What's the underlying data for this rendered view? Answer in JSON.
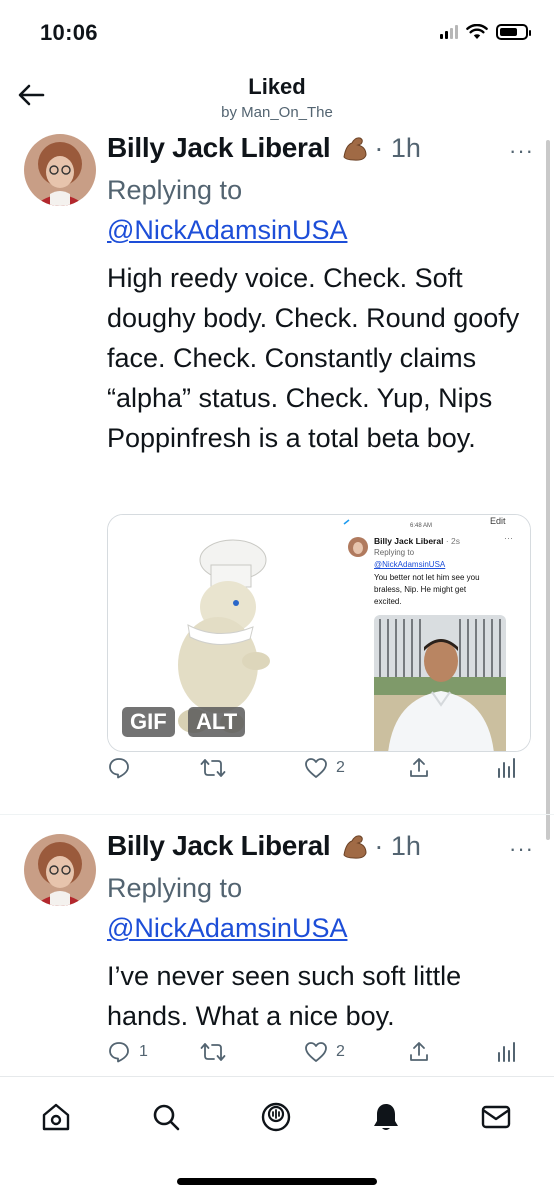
{
  "status_bar": {
    "time": "10:06"
  },
  "header": {
    "title": "Liked",
    "subtitle": "by Man_On_The"
  },
  "tweets": [
    {
      "author": "Billy Jack Liberal",
      "separator_time": "· 1h",
      "replying_label": "Replying to",
      "mention": "@NickAdamsinUSA",
      "text": "High reedy voice. Check. Soft doughy body. Check. Round goofy face. Check. Constantly claims “alpha” status. Check. Yup, Nips Poppinfresh is a total beta boy.",
      "more_label": "···",
      "media": {
        "gif_badge": "GIF",
        "alt_badge": "ALT",
        "screenshot": {
          "time": "6:48 AM",
          "edit": "Edit",
          "author": "Billy Jack Liberal",
          "age": "· 2s",
          "replying": "Replying to",
          "mention": "@NickAdamsinUSA",
          "text_line1": "You better not let him see you",
          "text_line2": "braless, Nip. He might get",
          "text_line3": "excited."
        }
      },
      "actions": {
        "replies": "",
        "retweets": "",
        "likes": "2"
      }
    },
    {
      "author": "Billy Jack Liberal",
      "separator_time": "· 1h",
      "replying_label": "Replying to",
      "mention": "@NickAdamsinUSA",
      "text": "I’ve never seen such soft little hands. What a nice boy.",
      "more_label": "···",
      "actions": {
        "replies": "1",
        "retweets": "",
        "likes": "2"
      }
    }
  ],
  "tabbar": {
    "items": [
      "home-icon",
      "search-icon",
      "spaces-icon",
      "notifications-icon",
      "messages-icon"
    ]
  },
  "colors": {
    "link": "#1d4ed8",
    "muted": "#536471"
  }
}
